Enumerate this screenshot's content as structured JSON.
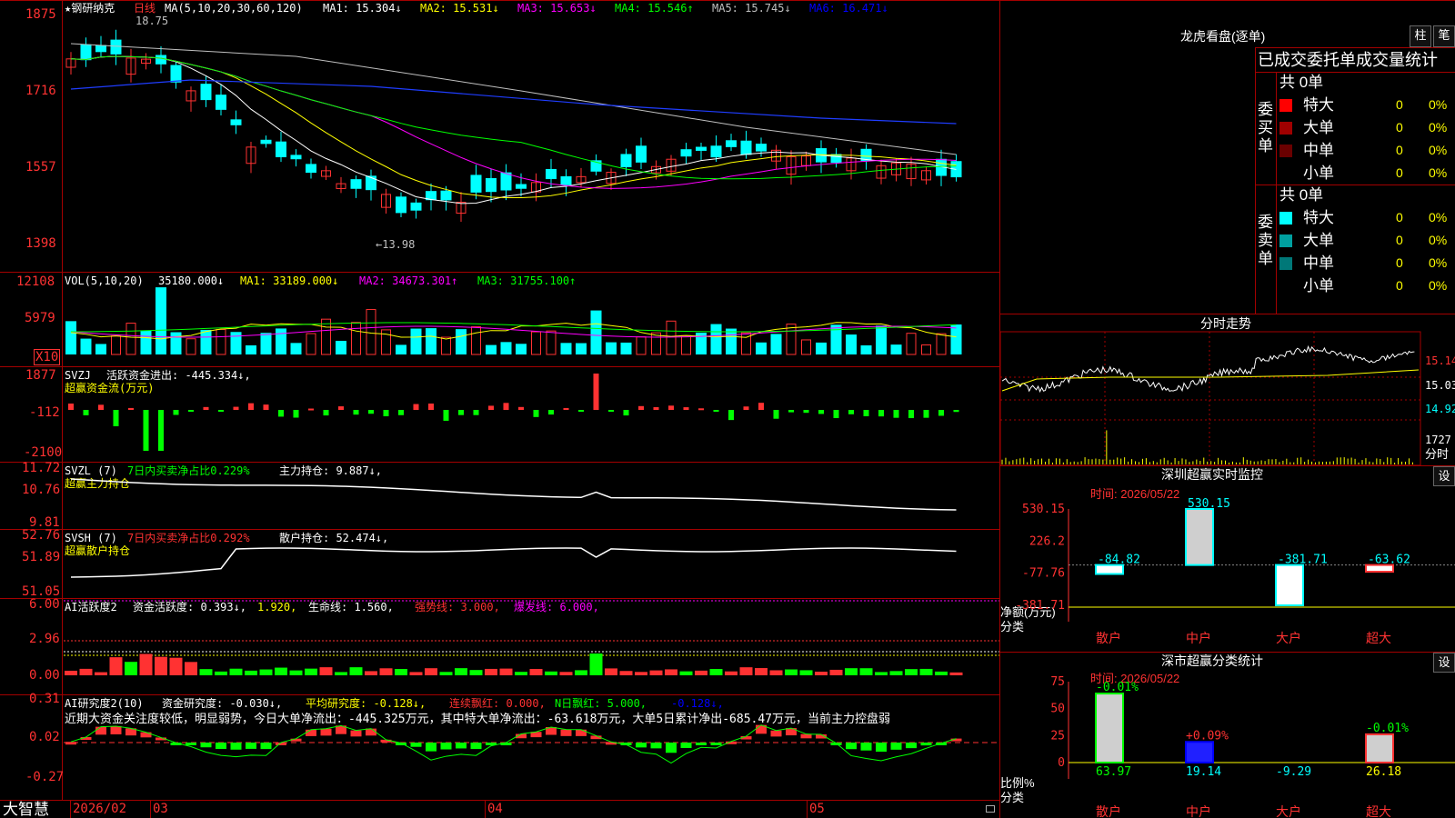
{
  "colors": {
    "up": "#ff3232",
    "down": "#00ffff",
    "ma1": "#ffffff",
    "ma2": "#ffff00",
    "ma3": "#ff00ff",
    "ma4": "#00ff00",
    "ma5": "#c0c0c0",
    "ma6": "#1f3dff",
    "grid": "#a40000"
  },
  "main": {
    "title": "★钢研纳克",
    "period": "日线",
    "ma_name": "MA(5,10,20,30,60,120)",
    "ma1": "MA1: 15.304↓",
    "ma2": "MA2: 15.531↓",
    "ma3": "MA3: 15.653↓",
    "ma4": "MA4: 15.546↑",
    "ma5": "MA5: 15.745↓",
    "ma6": "MA6: 16.471↓",
    "y_ticks": [
      "1875",
      "1716",
      "1557",
      "1398"
    ],
    "high_label": "18.75",
    "low_label": "←13.98"
  },
  "vol": {
    "label": "VOL(5,10,20)",
    "value": "35180.000↓",
    "ma1": "MA1: 33189.000↓",
    "ma2": "MA2: 34673.301↑",
    "ma3": "MA3: 31755.100↑",
    "y_ticks": [
      "12108",
      "5979"
    ],
    "unit": "X10"
  },
  "svzj": {
    "label": "SVZJ",
    "desc": "活跃资金进出: -445.334↓,",
    "sub": "超赢资金流(万元)",
    "y_ticks": [
      "1877",
      "-112",
      "-2100"
    ]
  },
  "svzl": {
    "label": "SVZL (7)",
    "pct": "7日内买卖净占比0.229%",
    "hold": "主力持仓: 9.887↓,",
    "sub": "超赢主力持仓",
    "y_ticks": [
      "11.72",
      "10.76",
      "9.81"
    ]
  },
  "svsh": {
    "label": "SVSH (7)",
    "pct": "7日内买卖净占比0.292%",
    "hold": "散户持仓: 52.474↓,",
    "sub": "超赢散户持仓",
    "y_ticks": [
      "52.76",
      "51.89",
      "51.05"
    ]
  },
  "ai1": {
    "label": "AI活跃度2",
    "a": "资金活跃度: 0.393↓,",
    "b": "1.920,",
    "c": "生命线: 1.560,",
    "d": "强势线: 3.000,",
    "e": "爆发线: 6.000,",
    "y_ticks": [
      "6.00",
      "2.96",
      "0.00"
    ]
  },
  "ai2": {
    "label": "AI研究度2(10)",
    "a": "资金研究度: -0.030↓,",
    "b": "平均研究度: -0.128↓,",
    "c": "连续飘红: 0.000,",
    "d": "N日飘红: 5.000,",
    "e": "-0.128↓,",
    "y_ticks": [
      "0.31",
      "0.02",
      "-0.27"
    ],
    "note": "近期大资金关注度较低，明显弱势，今日大单净流出：-445.325万元，其中特大单净流出：-63.618万元，大单5日累计净出-685.47万元，当前主力控盘弱"
  },
  "xaxis": {
    "brand": "大智慧",
    "labels": [
      "2026/02",
      "03",
      "04",
      "05"
    ]
  },
  "dragon": {
    "title": "龙虎看盘(逐单)",
    "btn1": "柱",
    "btn2": "笔",
    "header": "已成交委托单成交量统计",
    "buy": {
      "side": "委买单",
      "total": "共 0单",
      "rows": [
        {
          "name": "特大",
          "v": "0",
          "p": "0%",
          "c": "#ff0000"
        },
        {
          "name": "大单",
          "v": "0",
          "p": "0%",
          "c": "#a00000"
        },
        {
          "name": "中单",
          "v": "0",
          "p": "0%",
          "c": "#6a0000"
        },
        {
          "name": "小单",
          "v": "0",
          "p": "0%",
          "c": "#000000"
        }
      ]
    },
    "sell": {
      "side": "委卖单",
      "total": "共 0单",
      "rows": [
        {
          "name": "特大",
          "v": "0",
          "p": "0%",
          "c": "#00ffff"
        },
        {
          "name": "大单",
          "v": "0",
          "p": "0%",
          "c": "#00a0a0"
        },
        {
          "name": "中单",
          "v": "0",
          "p": "0%",
          "c": "#007878"
        },
        {
          "name": "小单",
          "v": "0",
          "p": "0%",
          "c": "#000000"
        }
      ]
    }
  },
  "intraday": {
    "title": "分时走势",
    "y_ticks": [
      "15.14",
      "15.03",
      "14.92"
    ],
    "vol_tick": "1727",
    "vol_label": "分时"
  },
  "monitor": {
    "title": "深圳超赢实时监控",
    "btn": "设",
    "time": "时间: 2026/05/22",
    "y_ticks": [
      "530.15",
      "226.2",
      "-77.76",
      "-381.71"
    ],
    "ylabel": "净额(万元)",
    "xlabel": "分类",
    "chart_data": {
      "type": "bar",
      "categories": [
        "散户",
        "中户",
        "大户",
        "超大"
      ],
      "values": [
        -84.82,
        530.15,
        -381.71,
        -63.62
      ],
      "ylim": [
        -381.71,
        530.15
      ]
    }
  },
  "stats": {
    "title": "深市超赢分类统计",
    "btn": "设",
    "time": "时间: 2026/05/22",
    "y_ticks": [
      "75",
      "50",
      "25",
      "0"
    ],
    "ylabel": "比例%",
    "xlabel": "分类",
    "chart_data": {
      "type": "bar",
      "categories": [
        "散户",
        "中户",
        "大户",
        "超大"
      ],
      "values": [
        63.97,
        19.14,
        -9.29,
        26.18
      ],
      "change": [
        "-0.01%",
        "+0.09%",
        "",
        "-0.01%"
      ],
      "ylim": [
        0,
        75
      ]
    }
  }
}
